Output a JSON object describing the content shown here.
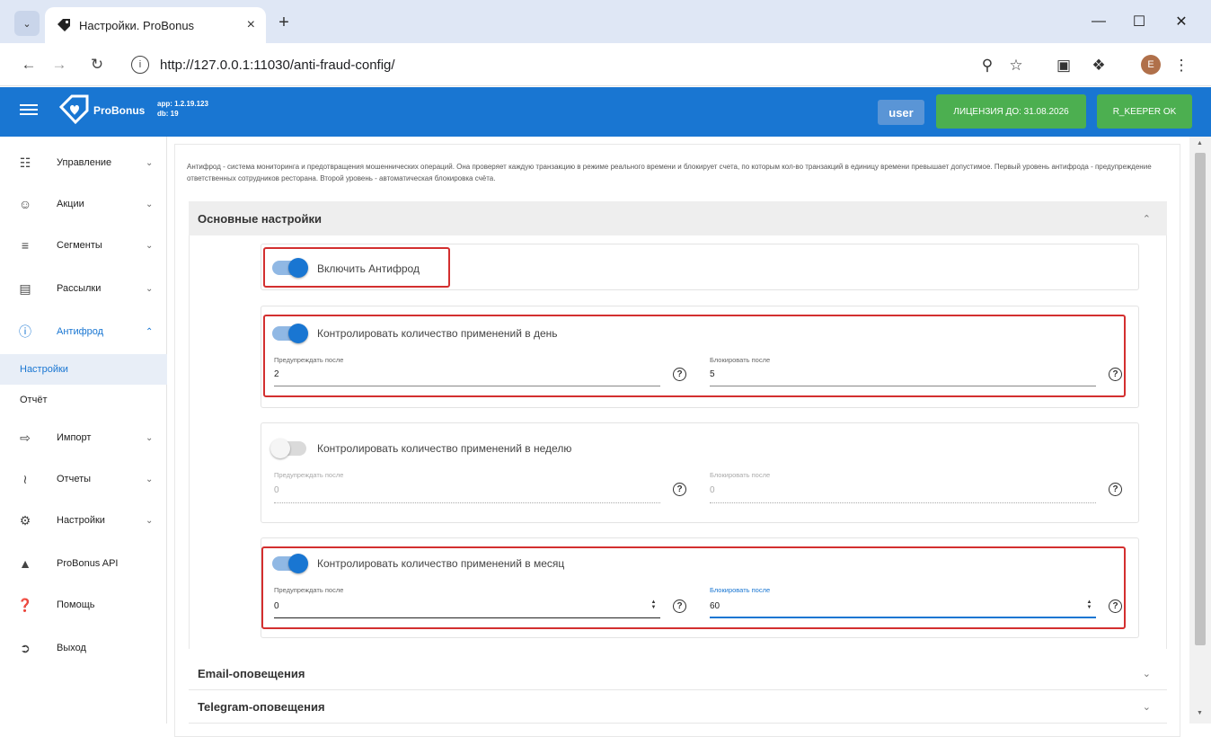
{
  "browser": {
    "tab_title": "Настройки. ProBonus",
    "tab_close": "×",
    "new_tab": "+",
    "url": "http://127.0.0.1:11030/anti-fraud-config/",
    "profile_initial": "E"
  },
  "header": {
    "logo_text": "ProBonus",
    "app_version": "app: 1.2.19.123",
    "db_version": "db: 19",
    "user_label": "user",
    "license_label": "ЛИЦЕНЗИЯ ДО: 31.08.2026",
    "rkeeper_label": "R_KEEPER OK",
    "colors": {
      "primary": "#1976d2",
      "success": "#4caf50"
    }
  },
  "sidebar": {
    "items": [
      {
        "label": "Управление",
        "icon": "clipboard-icon"
      },
      {
        "label": "Акции",
        "icon": "smile-icon"
      },
      {
        "label": "Сегменты",
        "icon": "list-icon"
      },
      {
        "label": "Рассылки",
        "icon": "newspaper-icon"
      },
      {
        "label": "Антифрод",
        "icon": "alert-circle-icon"
      },
      {
        "label": "Импорт",
        "icon": "import-icon"
      },
      {
        "label": "Отчеты",
        "icon": "chart-icon"
      },
      {
        "label": "Настройки",
        "icon": "gear-icon"
      },
      {
        "label": "ProBonus API",
        "icon": "api-icon"
      },
      {
        "label": "Помощь",
        "icon": "help-icon"
      },
      {
        "label": "Выход",
        "icon": "logout-icon"
      }
    ],
    "subitems": [
      {
        "label": "Настройки",
        "active": true
      },
      {
        "label": "Отчёт",
        "active": false
      }
    ]
  },
  "main": {
    "description": "Антифрод - система мониторинга и предотвращения мошеннических операций. Она проверяет каждую транзакцию в режиме реального времени и блокирует счета, по которым кол-во транзакций в единицу времени превышает допустимое. Первый уровень антифрода - предупреждение ответственных сотрудников ресторана. Второй уровень - автоматическая блокировка счёта.",
    "panel_title": "Основные настройки",
    "enable": {
      "label": "Включить Антифрод",
      "on": true
    },
    "day": {
      "label": "Контролировать количество применений в день",
      "on": true,
      "warn_label": "Предупреждать после",
      "warn_value": "2",
      "block_label": "Блокировать после",
      "block_value": "5"
    },
    "week": {
      "label": "Контролировать количество применений в неделю",
      "on": false,
      "warn_label": "Предупреждать после",
      "warn_value": "0",
      "block_label": "Блокировать после",
      "block_value": "0"
    },
    "month": {
      "label": "Контролировать количество применений в месяц",
      "on": true,
      "warn_label": "Предупреждать после",
      "warn_value": "0",
      "block_label": "Блокировать после",
      "block_value": "60"
    },
    "help_glyph": "?",
    "email_title": "Email-оповещения",
    "telegram_title": "Telegram-оповещения"
  }
}
